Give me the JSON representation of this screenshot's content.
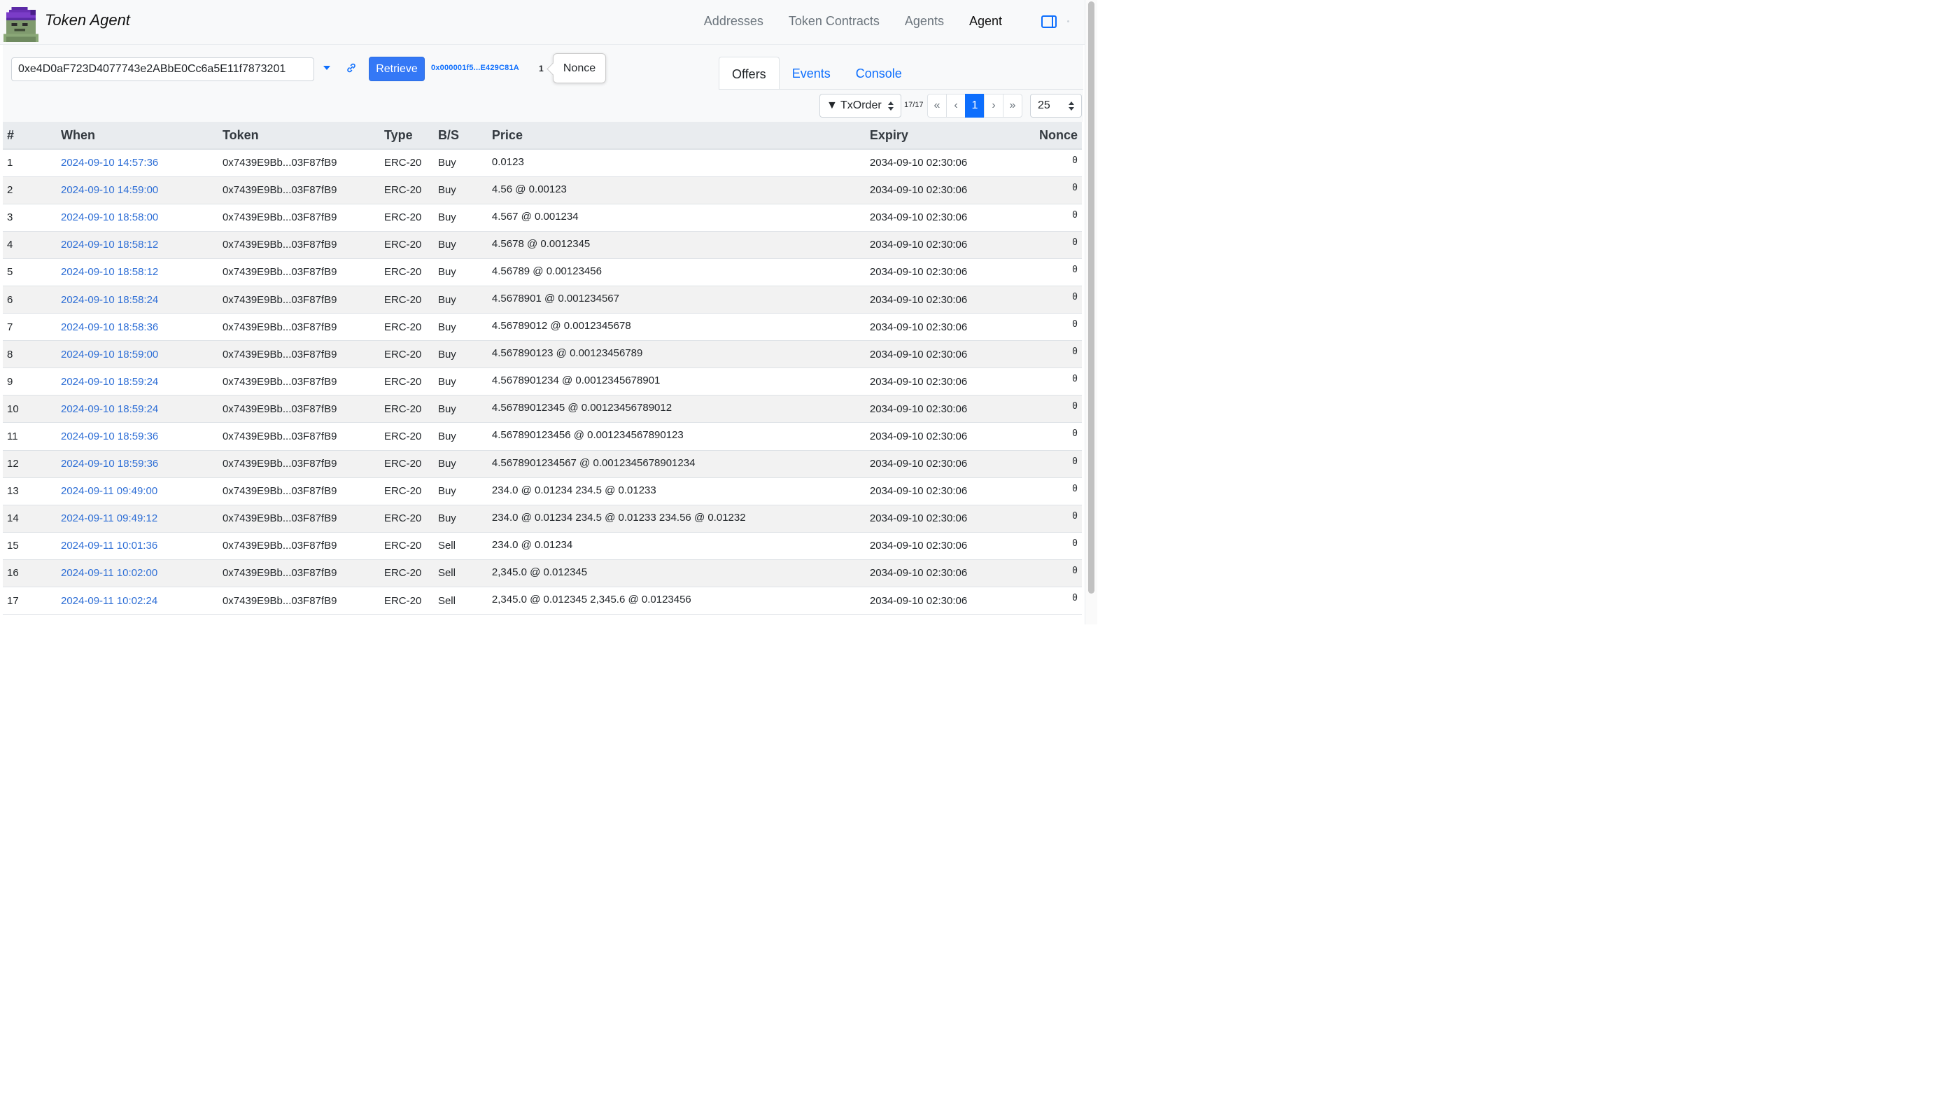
{
  "app": {
    "title": "Token Agent"
  },
  "nav": {
    "items": [
      "Addresses",
      "Token Contracts",
      "Agents",
      "Agent"
    ],
    "active": "Agent"
  },
  "toolbar": {
    "address_value": "0xe4D0aF723D4077743e2ABbE0Cc6a5E11f7873201",
    "retrieve_label": "Retrieve",
    "short_address": "0x000001f5...E429C81A",
    "nonce_value": "1",
    "nonce_tooltip": "Nonce"
  },
  "tabs": [
    {
      "label": "Offers",
      "active": true
    },
    {
      "label": "Events",
      "active": false
    },
    {
      "label": "Console",
      "active": false
    }
  ],
  "pagination": {
    "sort_label": "▼ TxOrder",
    "count": "17/17",
    "first": "«",
    "prev": "‹",
    "current": "1",
    "next": "›",
    "last": "»",
    "page_size": "25"
  },
  "table": {
    "headers": {
      "num": "#",
      "when": "When",
      "token": "Token",
      "type": "Type",
      "bs": "B/S",
      "price": "Price",
      "expiry": "Expiry",
      "nonce": "Nonce"
    },
    "rows": [
      {
        "num": "1",
        "when": "2024-09-10 14:57:36",
        "token": "0x7439E9Bb...03F87fB9",
        "type": "ERC-20",
        "bs": "Buy",
        "price": "0.0123",
        "expiry": "2034-09-10 02:30:06",
        "nonce": "0"
      },
      {
        "num": "2",
        "when": "2024-09-10 14:59:00",
        "token": "0x7439E9Bb...03F87fB9",
        "type": "ERC-20",
        "bs": "Buy",
        "price": "4.56 @ 0.00123",
        "expiry": "2034-09-10 02:30:06",
        "nonce": "0"
      },
      {
        "num": "3",
        "when": "2024-09-10 18:58:00",
        "token": "0x7439E9Bb...03F87fB9",
        "type": "ERC-20",
        "bs": "Buy",
        "price": "4.567 @ 0.001234",
        "expiry": "2034-09-10 02:30:06",
        "nonce": "0"
      },
      {
        "num": "4",
        "when": "2024-09-10 18:58:12",
        "token": "0x7439E9Bb...03F87fB9",
        "type": "ERC-20",
        "bs": "Buy",
        "price": "4.5678 @ 0.0012345",
        "expiry": "2034-09-10 02:30:06",
        "nonce": "0"
      },
      {
        "num": "5",
        "when": "2024-09-10 18:58:12",
        "token": "0x7439E9Bb...03F87fB9",
        "type": "ERC-20",
        "bs": "Buy",
        "price": "4.56789 @ 0.00123456",
        "expiry": "2034-09-10 02:30:06",
        "nonce": "0"
      },
      {
        "num": "6",
        "when": "2024-09-10 18:58:24",
        "token": "0x7439E9Bb...03F87fB9",
        "type": "ERC-20",
        "bs": "Buy",
        "price": "4.5678901 @ 0.001234567",
        "expiry": "2034-09-10 02:30:06",
        "nonce": "0"
      },
      {
        "num": "7",
        "when": "2024-09-10 18:58:36",
        "token": "0x7439E9Bb...03F87fB9",
        "type": "ERC-20",
        "bs": "Buy",
        "price": "4.56789012 @ 0.0012345678",
        "expiry": "2034-09-10 02:30:06",
        "nonce": "0"
      },
      {
        "num": "8",
        "when": "2024-09-10 18:59:00",
        "token": "0x7439E9Bb...03F87fB9",
        "type": "ERC-20",
        "bs": "Buy",
        "price": "4.567890123 @ 0.00123456789",
        "expiry": "2034-09-10 02:30:06",
        "nonce": "0"
      },
      {
        "num": "9",
        "when": "2024-09-10 18:59:24",
        "token": "0x7439E9Bb...03F87fB9",
        "type": "ERC-20",
        "bs": "Buy",
        "price": "4.5678901234 @ 0.0012345678901",
        "expiry": "2034-09-10 02:30:06",
        "nonce": "0"
      },
      {
        "num": "10",
        "when": "2024-09-10 18:59:24",
        "token": "0x7439E9Bb...03F87fB9",
        "type": "ERC-20",
        "bs": "Buy",
        "price": "4.56789012345 @ 0.00123456789012",
        "expiry": "2034-09-10 02:30:06",
        "nonce": "0"
      },
      {
        "num": "11",
        "when": "2024-09-10 18:59:36",
        "token": "0x7439E9Bb...03F87fB9",
        "type": "ERC-20",
        "bs": "Buy",
        "price": "4.567890123456 @ 0.001234567890123",
        "expiry": "2034-09-10 02:30:06",
        "nonce": "0"
      },
      {
        "num": "12",
        "when": "2024-09-10 18:59:36",
        "token": "0x7439E9Bb...03F87fB9",
        "type": "ERC-20",
        "bs": "Buy",
        "price": "4.5678901234567 @ 0.0012345678901234",
        "expiry": "2034-09-10 02:30:06",
        "nonce": "0"
      },
      {
        "num": "13",
        "when": "2024-09-11 09:49:00",
        "token": "0x7439E9Bb...03F87fB9",
        "type": "ERC-20",
        "bs": "Buy",
        "price": "234.0 @ 0.01234 234.5 @ 0.01233",
        "expiry": "2034-09-10 02:30:06",
        "nonce": "0"
      },
      {
        "num": "14",
        "when": "2024-09-11 09:49:12",
        "token": "0x7439E9Bb...03F87fB9",
        "type": "ERC-20",
        "bs": "Buy",
        "price": "234.0 @ 0.01234 234.5 @ 0.01233 234.56 @ 0.01232",
        "expiry": "2034-09-10 02:30:06",
        "nonce": "0"
      },
      {
        "num": "15",
        "when": "2024-09-11 10:01:36",
        "token": "0x7439E9Bb...03F87fB9",
        "type": "ERC-20",
        "bs": "Sell",
        "price": "234.0 @ 0.01234",
        "expiry": "2034-09-10 02:30:06",
        "nonce": "0"
      },
      {
        "num": "16",
        "when": "2024-09-11 10:02:00",
        "token": "0x7439E9Bb...03F87fB9",
        "type": "ERC-20",
        "bs": "Sell",
        "price": "2,345.0 @ 0.012345",
        "expiry": "2034-09-10 02:30:06",
        "nonce": "0"
      },
      {
        "num": "17",
        "when": "2024-09-11 10:02:24",
        "token": "0x7439E9Bb...03F87fB9",
        "type": "ERC-20",
        "bs": "Sell",
        "price": "2,345.0 @ 0.012345 2,345.6 @ 0.0123456",
        "expiry": "2034-09-10 02:30:06",
        "nonce": "0"
      }
    ]
  },
  "icons": {
    "logo": "pixel-avatar-icon",
    "sidebar": "sidebar-toggle-icon",
    "link": "link-icon",
    "dropdown": "chevron-down-icon"
  },
  "colors": {
    "primary": "#0d6efd",
    "link": "#2f6fd6",
    "logo_hat": "#6a2fb5",
    "logo_face": "#7a9a6a"
  }
}
